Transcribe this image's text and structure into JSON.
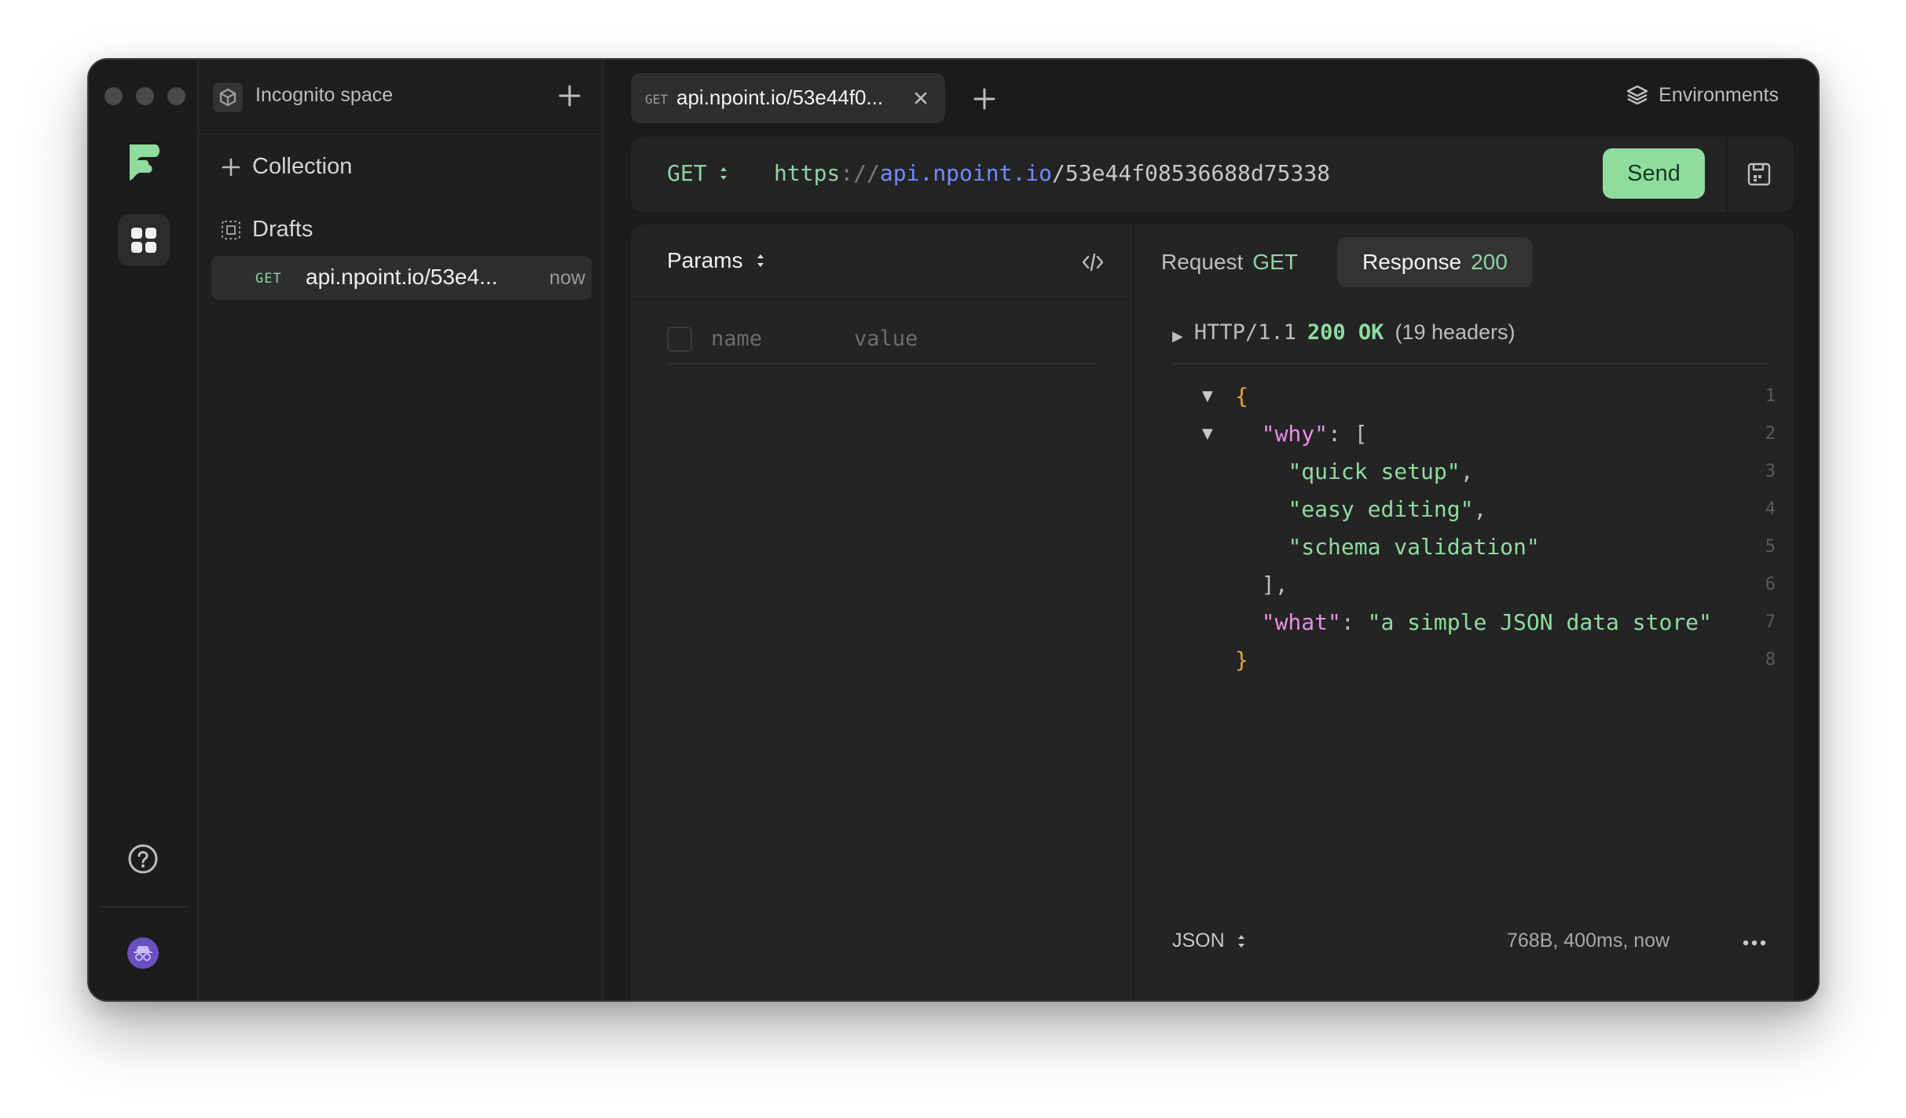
{
  "sidebar": {
    "space_name": "Incognito space",
    "collection_label": "Collection",
    "drafts_label": "Drafts",
    "draft": {
      "method": "GET",
      "url": "api.npoint.io/53e4...",
      "time": "now"
    }
  },
  "tab": {
    "method": "GET",
    "title": "api.npoint.io/53e44f0..."
  },
  "environments_label": "Environments",
  "request": {
    "method": "GET",
    "url_scheme": "https",
    "url_sep": "://",
    "url_host": "api.npoint.io",
    "url_path": "/53e44f08536688d75338",
    "send_label": "Send"
  },
  "params": {
    "label": "Params",
    "name_placeholder": "name",
    "value_placeholder": "value"
  },
  "response_tabs": {
    "request_label": "Request",
    "request_value": "GET",
    "response_label": "Response",
    "response_value": "200"
  },
  "status": {
    "protocol": "HTTP/1.1",
    "code": "200 OK",
    "headers": "(19 headers)"
  },
  "body": {
    "open_brace": "{",
    "why_key": "\"why\"",
    "colon_bracket": ": [",
    "item1": "\"quick setup\"",
    "item2": "\"easy editing\"",
    "item3": "\"schema validation\"",
    "comma": ",",
    "close_bracket": "],",
    "what_key": "\"what\"",
    "colon": ": ",
    "what_value": "\"a simple JSON data store\"",
    "close_brace": "}",
    "line_numbers": [
      "1",
      "2",
      "3",
      "4",
      "5",
      "6",
      "7",
      "8"
    ]
  },
  "footer": {
    "format": "JSON",
    "meta": "768B, 400ms, now"
  },
  "colors": {
    "accent_green": "#8fdc9f",
    "key_pink": "#e88ee6",
    "brace_orange": "#e0a24a",
    "url_host_blue": "#6f8cff",
    "avatar_purple": "#6a4fbf"
  }
}
